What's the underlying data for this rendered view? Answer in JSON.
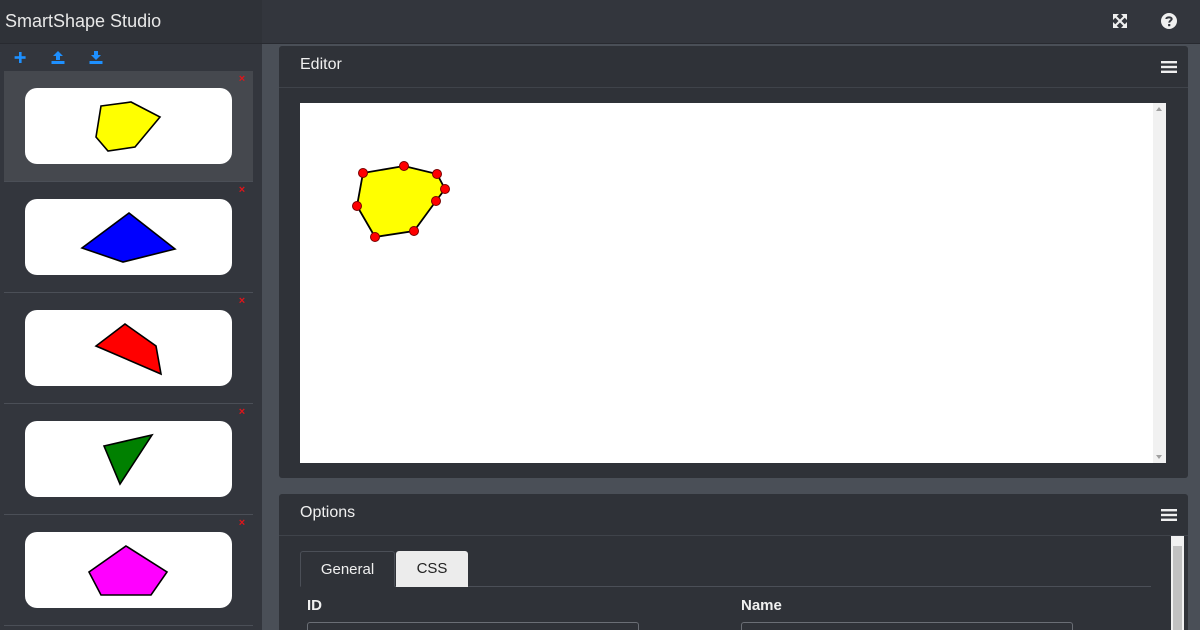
{
  "app": {
    "title": "SmartShape Studio"
  },
  "sidebar": {
    "toolbar": [
      {
        "icon": "plus-icon",
        "label": "Add shape"
      },
      {
        "icon": "upload-icon",
        "label": "Import"
      },
      {
        "icon": "download-icon",
        "label": "Export"
      }
    ],
    "shapes": [
      {
        "name": "yellow-polygon",
        "color": "#ffff00",
        "selected": true
      },
      {
        "name": "blue-polygon",
        "color": "#0000ff",
        "selected": false
      },
      {
        "name": "red-polygon",
        "color": "#ff0000",
        "selected": false
      },
      {
        "name": "green-triangle",
        "color": "#008000",
        "selected": false
      },
      {
        "name": "magenta-pentagon",
        "color": "#ff00ff",
        "selected": false
      }
    ],
    "delete_glyph": "×"
  },
  "topbar": {
    "icons": [
      "fullscreen-icon",
      "help-icon"
    ]
  },
  "editor": {
    "title": "Editor",
    "selected_shape_color": "#ffff00",
    "point_color": "#ff0000"
  },
  "options": {
    "title": "Options",
    "tabs": [
      {
        "label": "General",
        "active": true
      },
      {
        "label": "CSS",
        "active": false
      }
    ],
    "fields": {
      "id_label": "ID",
      "name_label": "Name"
    }
  },
  "colors": {
    "accent": "#1e90ff",
    "delete": "#e0151a",
    "panel_bg": "#2f3238",
    "page_bg": "#4a4f57"
  }
}
